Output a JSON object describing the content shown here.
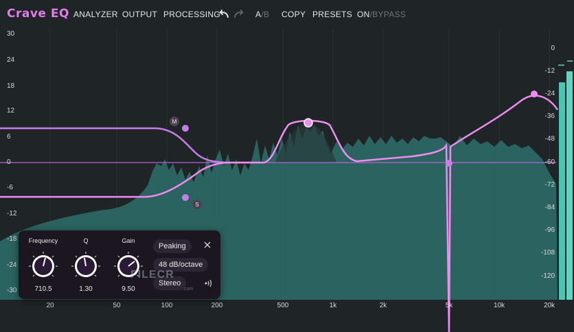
{
  "app": {
    "logo": "Crave EQ"
  },
  "menu": {
    "analyzer": "ANALYZER",
    "output": "OUTPUT",
    "processing": "PROCESSING",
    "ab_a": "A",
    "ab_sep": "/",
    "ab_b": "B",
    "copy": "COPY",
    "presets": "PRESETS",
    "on": "ON",
    "bypass": "/BYPASS"
  },
  "icons": {
    "undo": "undo-arrow-icon",
    "redo": "redo-arrow-icon",
    "close": "close-icon",
    "stereo": "stereo-width-icon"
  },
  "y_axis_left": [
    "30",
    "24",
    "18",
    "12",
    "6",
    "0",
    "-6",
    "-12",
    "-18",
    "-24",
    "-30"
  ],
  "y_axis_right": [
    "0",
    "-12",
    "-24",
    "-36",
    "-48",
    "-60",
    "-72",
    "-84",
    "-96",
    "-108",
    "-120"
  ],
  "x_axis": [
    "20",
    "50",
    "100",
    "200",
    "500",
    "1k",
    "2k",
    "5k",
    "10k",
    "20k"
  ],
  "band_tags": {
    "mid": "M",
    "side": "S"
  },
  "band_panel": {
    "frequency_label": "Frequency",
    "frequency_value": "710.5",
    "q_label": "Q",
    "q_value": "1.30",
    "gain_label": "Gain",
    "gain_value": "9.50",
    "filter_type": "Peaking",
    "slope": "48 dB/octave",
    "channel": "Stereo"
  },
  "watermark": {
    "main": "FILECR",
    "sub": ".com"
  },
  "colors": {
    "accent": "#e57be6",
    "curve": "#f08cf0",
    "curve_alt": "#c77de8",
    "spectrum": "#2f7e78",
    "meter": "#5ed6c4",
    "background": "#1f2426"
  }
}
